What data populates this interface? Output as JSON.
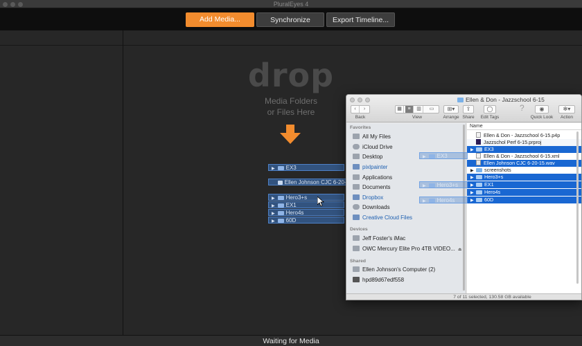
{
  "window": {
    "title": "PluralEyes 4"
  },
  "toolbar": {
    "add_media": "Add Media...",
    "synchronize": "Synchronize",
    "export_timeline": "Export Timeline..."
  },
  "drop_zone": {
    "headline": "drop",
    "line1": "Media Folders",
    "line2": "or Files Here"
  },
  "status": {
    "text": "Waiting for Media"
  },
  "drag_items": [
    "EX3",
    "Ellen Johnson CJC 6-20-15.wav",
    "Hero3+s",
    "EX1",
    "Hero4s",
    "60D"
  ],
  "finder": {
    "title": "Ellen & Don - Jazzschool 6-15",
    "toolbar_labels": {
      "back": "Back",
      "view": "View",
      "arrange": "Arrange",
      "share": "Share",
      "edit_tags": "Edit Tags",
      "quick_look": "Quick Look",
      "action": "Action"
    },
    "sidebar": {
      "favorites_heading": "Favorites",
      "favorites": [
        "All My Files",
        "iCloud Drive",
        "Desktop",
        "pixlpainter",
        "Applications",
        "Documents",
        "Dropbox",
        "Downloads",
        "Creative Cloud Files"
      ],
      "devices_heading": "Devices",
      "devices": [
        "Jeff Foster's iMac",
        "OWC Mercury Elite Pro 4TB VIDEO..."
      ],
      "shared_heading": "Shared",
      "shared": [
        "Ellen Johnson's Computer (2)",
        "hpd89d67edf558"
      ]
    },
    "column_header": "Name",
    "files": [
      {
        "name": "Ellen & Don - Jazzschool 6-15.p4p",
        "kind": "doc",
        "selected": false
      },
      {
        "name": "Jazzschol Perf 6-15.prproj",
        "kind": "premiere",
        "selected": false
      },
      {
        "name": "EX3",
        "kind": "folder",
        "selected": true
      },
      {
        "name": "Ellen & Don - Jazzschool 6-15.xml",
        "kind": "doc",
        "selected": false
      },
      {
        "name": "Ellen Johnson CJC 6-20-15.wav",
        "kind": "audio",
        "selected": true
      },
      {
        "name": "screenshots",
        "kind": "folder",
        "selected": false
      },
      {
        "name": "Hero3+s",
        "kind": "folder",
        "selected": true
      },
      {
        "name": "EX1",
        "kind": "folder",
        "selected": true
      },
      {
        "name": "Hero4s",
        "kind": "folder",
        "selected": true
      },
      {
        "name": "60D",
        "kind": "folder",
        "selected": true
      }
    ],
    "status": "7 of 11 selected, 130.58 GB available"
  },
  "colors": {
    "accent": "#f28c2e",
    "selection": "#1967d2",
    "background": "#262626"
  },
  "icons": {
    "drop_arrow": "arrow-down-icon",
    "cursor": "arrow-pointer-icon"
  }
}
